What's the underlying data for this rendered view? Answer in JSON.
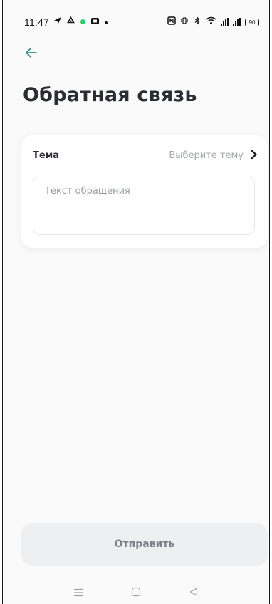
{
  "status_bar": {
    "time": "11:47",
    "battery": "90"
  },
  "header": {
    "title": "Обратная связь"
  },
  "form": {
    "topic_label": "Тема",
    "topic_placeholder": "Выберите тему",
    "message_placeholder": "Текст обращения",
    "message_value": ""
  },
  "submit": {
    "label": "Отправить"
  },
  "colors": {
    "accent": "#3a8f85",
    "title": "#2a2e33",
    "placeholder": "#a3a7ab",
    "button_bg": "#eeeff1",
    "button_text": "#7e8287"
  },
  "icons": {
    "back": "arrow-left-icon",
    "topic_chevron": "chevron-right-icon",
    "nav_menu": "menu-icon",
    "nav_home": "home-icon",
    "nav_back": "back-triangle-icon"
  }
}
